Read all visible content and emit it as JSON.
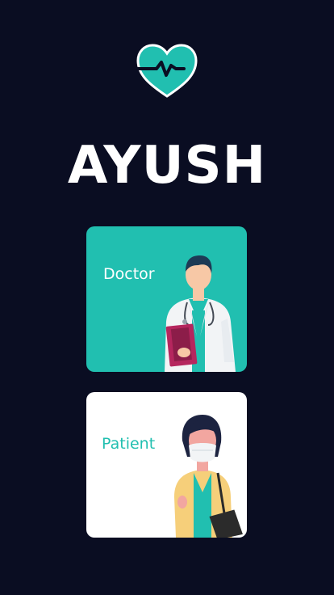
{
  "app": {
    "title": "AYUSH",
    "logo_icon": "heart-pulse-icon"
  },
  "roles": [
    {
      "label": "Doctor",
      "icon": "doctor-illustration"
    },
    {
      "label": "Patient",
      "icon": "patient-illustration"
    }
  ],
  "colors": {
    "background": "#0a0d22",
    "accent": "#21bfb0",
    "card_light": "#ffffff"
  }
}
